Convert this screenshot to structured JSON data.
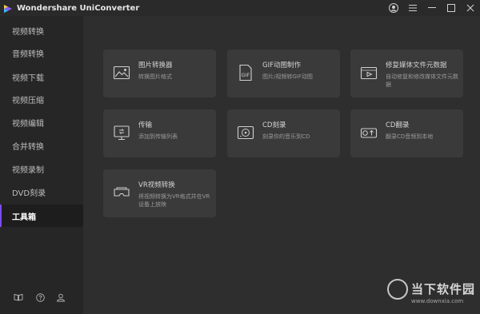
{
  "app": {
    "title": "Wondershare UniConverter"
  },
  "sidebar": {
    "items": [
      {
        "label": "视频转换"
      },
      {
        "label": "音频转换"
      },
      {
        "label": "视频下载"
      },
      {
        "label": "视频压缩"
      },
      {
        "label": "视频编辑"
      },
      {
        "label": "合并转换"
      },
      {
        "label": "视频录制"
      },
      {
        "label": "DVD刻录"
      },
      {
        "label": "工具箱"
      }
    ],
    "bottom_icons": [
      "book-icon",
      "help-icon",
      "account-icon"
    ]
  },
  "tools": [
    {
      "title": "图片转换器",
      "desc": "转换图片格式",
      "icon": "image-convert-icon"
    },
    {
      "title": "GIF动图制作",
      "desc": "图片/视频转GIF动图",
      "icon": "gif-icon"
    },
    {
      "title": "修复媒体文件元数据",
      "desc": "自动修复和修改媒体文件元数据",
      "icon": "metadata-icon"
    },
    {
      "title": "传输",
      "desc": "添加到传输列表",
      "icon": "transfer-icon"
    },
    {
      "title": "CD刻录",
      "desc": "刻录你的音乐到CD",
      "icon": "cd-burn-icon"
    },
    {
      "title": "CD翻录",
      "desc": "翻录CD音频到本地",
      "icon": "cd-rip-icon"
    },
    {
      "title": "VR视频转换",
      "desc": "将视频转换为VR格式并在VR设备上放映",
      "icon": "vr-icon"
    }
  ],
  "watermark": {
    "text": "当下软件园",
    "url": "www.downxia.com"
  },
  "colors": {
    "accent": "#7b4df2",
    "sidebar_bg": "#262626",
    "main_bg": "#2e2e2e",
    "card_bg": "#3a3a3a"
  }
}
